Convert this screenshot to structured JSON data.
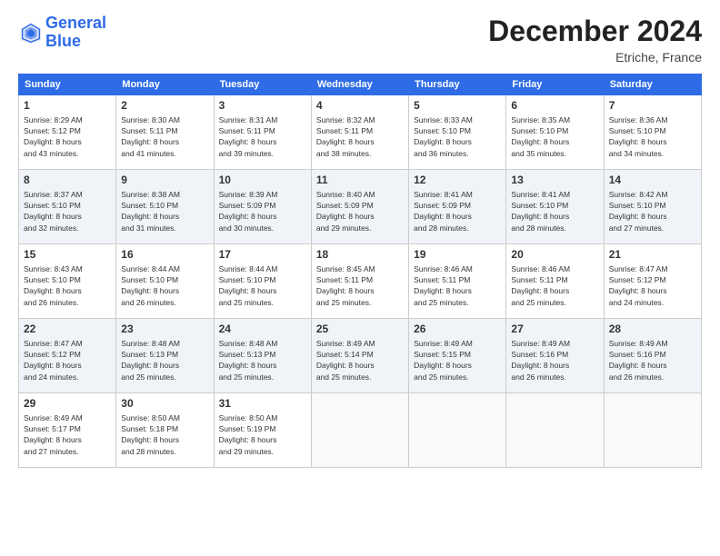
{
  "header": {
    "logo_line1": "General",
    "logo_line2": "Blue",
    "month_title": "December 2024",
    "location": "Etriche, France"
  },
  "days_of_week": [
    "Sunday",
    "Monday",
    "Tuesday",
    "Wednesday",
    "Thursday",
    "Friday",
    "Saturday"
  ],
  "weeks": [
    [
      {
        "day": "1",
        "info": "Sunrise: 8:29 AM\nSunset: 5:12 PM\nDaylight: 8 hours\nand 43 minutes."
      },
      {
        "day": "2",
        "info": "Sunrise: 8:30 AM\nSunset: 5:11 PM\nDaylight: 8 hours\nand 41 minutes."
      },
      {
        "day": "3",
        "info": "Sunrise: 8:31 AM\nSunset: 5:11 PM\nDaylight: 8 hours\nand 39 minutes."
      },
      {
        "day": "4",
        "info": "Sunrise: 8:32 AM\nSunset: 5:11 PM\nDaylight: 8 hours\nand 38 minutes."
      },
      {
        "day": "5",
        "info": "Sunrise: 8:33 AM\nSunset: 5:10 PM\nDaylight: 8 hours\nand 36 minutes."
      },
      {
        "day": "6",
        "info": "Sunrise: 8:35 AM\nSunset: 5:10 PM\nDaylight: 8 hours\nand 35 minutes."
      },
      {
        "day": "7",
        "info": "Sunrise: 8:36 AM\nSunset: 5:10 PM\nDaylight: 8 hours\nand 34 minutes."
      }
    ],
    [
      {
        "day": "8",
        "info": "Sunrise: 8:37 AM\nSunset: 5:10 PM\nDaylight: 8 hours\nand 32 minutes."
      },
      {
        "day": "9",
        "info": "Sunrise: 8:38 AM\nSunset: 5:10 PM\nDaylight: 8 hours\nand 31 minutes."
      },
      {
        "day": "10",
        "info": "Sunrise: 8:39 AM\nSunset: 5:09 PM\nDaylight: 8 hours\nand 30 minutes."
      },
      {
        "day": "11",
        "info": "Sunrise: 8:40 AM\nSunset: 5:09 PM\nDaylight: 8 hours\nand 29 minutes."
      },
      {
        "day": "12",
        "info": "Sunrise: 8:41 AM\nSunset: 5:09 PM\nDaylight: 8 hours\nand 28 minutes."
      },
      {
        "day": "13",
        "info": "Sunrise: 8:41 AM\nSunset: 5:10 PM\nDaylight: 8 hours\nand 28 minutes."
      },
      {
        "day": "14",
        "info": "Sunrise: 8:42 AM\nSunset: 5:10 PM\nDaylight: 8 hours\nand 27 minutes."
      }
    ],
    [
      {
        "day": "15",
        "info": "Sunrise: 8:43 AM\nSunset: 5:10 PM\nDaylight: 8 hours\nand 26 minutes."
      },
      {
        "day": "16",
        "info": "Sunrise: 8:44 AM\nSunset: 5:10 PM\nDaylight: 8 hours\nand 26 minutes."
      },
      {
        "day": "17",
        "info": "Sunrise: 8:44 AM\nSunset: 5:10 PM\nDaylight: 8 hours\nand 25 minutes."
      },
      {
        "day": "18",
        "info": "Sunrise: 8:45 AM\nSunset: 5:11 PM\nDaylight: 8 hours\nand 25 minutes."
      },
      {
        "day": "19",
        "info": "Sunrise: 8:46 AM\nSunset: 5:11 PM\nDaylight: 8 hours\nand 25 minutes."
      },
      {
        "day": "20",
        "info": "Sunrise: 8:46 AM\nSunset: 5:11 PM\nDaylight: 8 hours\nand 25 minutes."
      },
      {
        "day": "21",
        "info": "Sunrise: 8:47 AM\nSunset: 5:12 PM\nDaylight: 8 hours\nand 24 minutes."
      }
    ],
    [
      {
        "day": "22",
        "info": "Sunrise: 8:47 AM\nSunset: 5:12 PM\nDaylight: 8 hours\nand 24 minutes."
      },
      {
        "day": "23",
        "info": "Sunrise: 8:48 AM\nSunset: 5:13 PM\nDaylight: 8 hours\nand 25 minutes."
      },
      {
        "day": "24",
        "info": "Sunrise: 8:48 AM\nSunset: 5:13 PM\nDaylight: 8 hours\nand 25 minutes."
      },
      {
        "day": "25",
        "info": "Sunrise: 8:49 AM\nSunset: 5:14 PM\nDaylight: 8 hours\nand 25 minutes."
      },
      {
        "day": "26",
        "info": "Sunrise: 8:49 AM\nSunset: 5:15 PM\nDaylight: 8 hours\nand 25 minutes."
      },
      {
        "day": "27",
        "info": "Sunrise: 8:49 AM\nSunset: 5:16 PM\nDaylight: 8 hours\nand 26 minutes."
      },
      {
        "day": "28",
        "info": "Sunrise: 8:49 AM\nSunset: 5:16 PM\nDaylight: 8 hours\nand 26 minutes."
      }
    ],
    [
      {
        "day": "29",
        "info": "Sunrise: 8:49 AM\nSunset: 5:17 PM\nDaylight: 8 hours\nand 27 minutes."
      },
      {
        "day": "30",
        "info": "Sunrise: 8:50 AM\nSunset: 5:18 PM\nDaylight: 8 hours\nand 28 minutes."
      },
      {
        "day": "31",
        "info": "Sunrise: 8:50 AM\nSunset: 5:19 PM\nDaylight: 8 hours\nand 29 minutes."
      },
      {
        "day": "",
        "info": ""
      },
      {
        "day": "",
        "info": ""
      },
      {
        "day": "",
        "info": ""
      },
      {
        "day": "",
        "info": ""
      }
    ]
  ]
}
